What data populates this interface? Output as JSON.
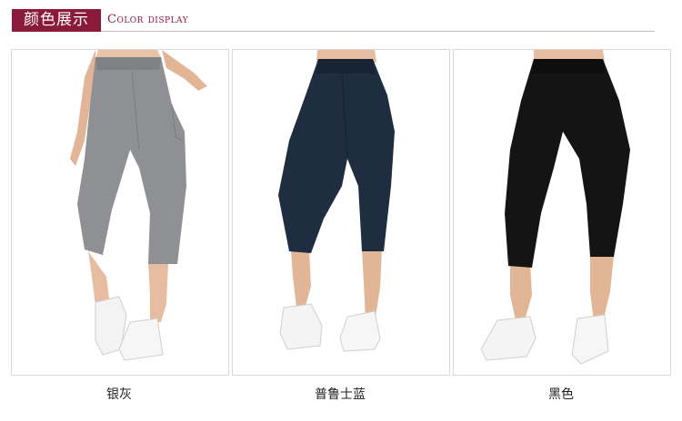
{
  "header": {
    "title_cn": "颜色展示",
    "title_en": "Color display",
    "accent_color": "#8b1a3a"
  },
  "products": [
    {
      "caption": "银灰",
      "color": "#8e9093"
    },
    {
      "caption": "普鲁士蓝",
      "color": "#1f2d40"
    },
    {
      "caption": "黑色",
      "color": "#141414"
    }
  ]
}
